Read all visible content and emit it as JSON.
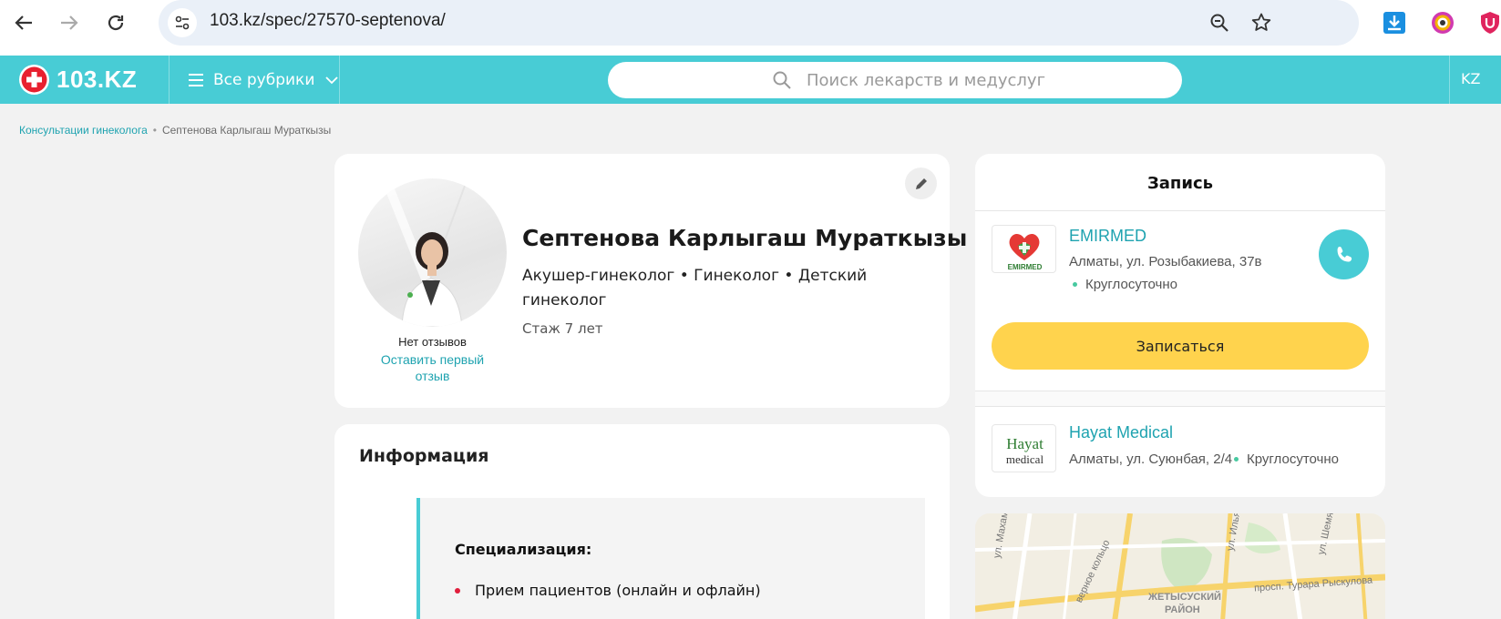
{
  "browser": {
    "url": "103.kz/spec/27570-septenova/"
  },
  "header": {
    "logo_text": "103.KZ",
    "rubrics_label": "Все рубрики",
    "search_placeholder": "Поиск лекарств и медуслуг",
    "language": "KZ"
  },
  "breadcrumb": {
    "parent": "Консультации гинеколога",
    "current": "Септенова Карлыгаш Мураткызы"
  },
  "profile": {
    "name": "Септенова Карлыгаш Мураткызы",
    "specialties": "Акушер-гинеколог • Гинеколог • Детский гинеколог",
    "experience": "Стаж 7 лет",
    "reviews_status": "Нет отзывов",
    "reviews_link": "Оставить первый отзыв"
  },
  "info": {
    "title": "Информация",
    "subtitle": "Специализация:",
    "items": [
      "Прием пациентов (онлайн и офлайн)"
    ]
  },
  "booking": {
    "title": "Запись",
    "button_label": "Записаться",
    "clinics": [
      {
        "name": "EMIRMED",
        "address": "Алматы, ул. Розыбакиева, 37в",
        "hours": "Круглосуточно",
        "logo_text": "EMIRMED"
      },
      {
        "name": "Hayat Medical",
        "address": "Алматы, ул. Суюнбая, 2/4",
        "hours": "Круглосуточно",
        "logo_text_top": "Hayat",
        "logo_text_bottom": "medical"
      }
    ]
  },
  "map": {
    "labels": [
      "ул. Махамбета Утемисова",
      "верное кольцо",
      "ЖЕТЫСУСКИЙ",
      "РАЙОН",
      "просп. Турара Рыскулова",
      "ул. Ильяева",
      "ул. Шемякина"
    ]
  },
  "colors": {
    "brand_teal": "#48ccd5",
    "link_teal": "#1fa3b0",
    "button_yellow": "#ffd34d",
    "bullet_red": "#e01e3c"
  },
  "icons": [
    "back-arrow-icon",
    "forward-arrow-icon",
    "reload-icon",
    "site-info-icon",
    "zoom-icon",
    "star-icon",
    "download-icon",
    "extension-icon",
    "shield-extension-icon",
    "menu-icon",
    "chevron-down-icon",
    "search-icon",
    "edit-icon",
    "phone-icon"
  ]
}
